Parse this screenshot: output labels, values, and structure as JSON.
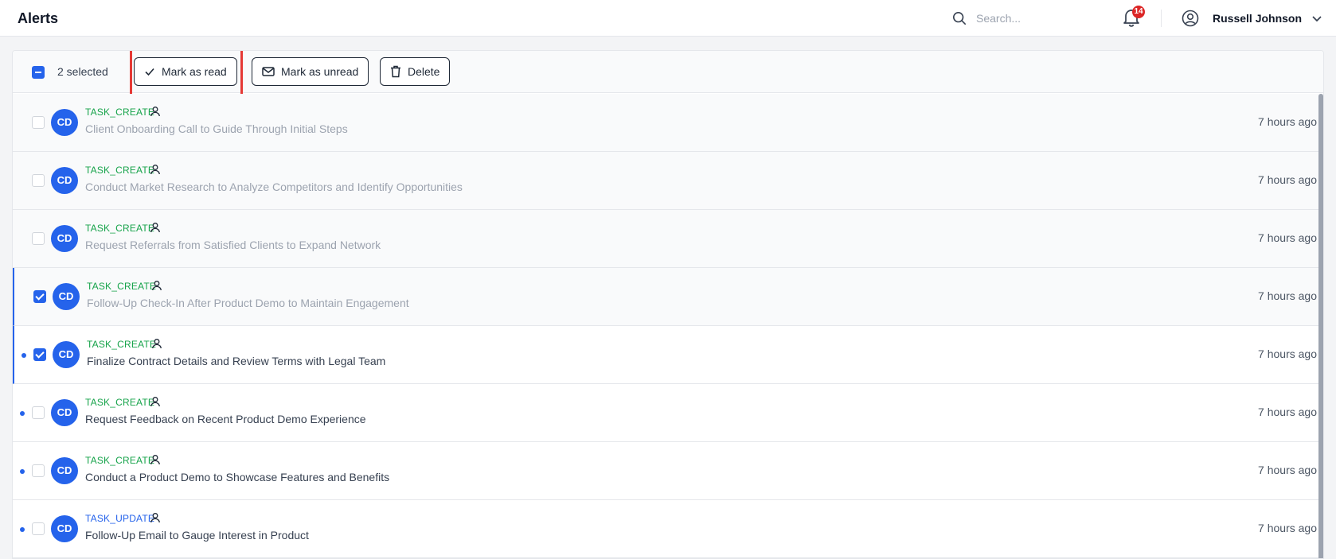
{
  "app": {
    "title": "Alerts"
  },
  "search": {
    "placeholder": "Search..."
  },
  "notifications": {
    "count": "14"
  },
  "user": {
    "name": "Russell Johnson"
  },
  "toolbar": {
    "selected_label": "2 selected",
    "mark_read_label": "Mark as read",
    "mark_unread_label": "Mark as unread",
    "delete_label": "Delete"
  },
  "alerts": [
    {
      "avatar": "CD",
      "type": "TASK_CREATE",
      "title": "Client Onboarding Call to Guide Through Initial Steps",
      "time": "7 hours ago",
      "read": true,
      "checked": false
    },
    {
      "avatar": "CD",
      "type": "TASK_CREATE",
      "title": "Conduct Market Research to Analyze Competitors and Identify Opportunities",
      "time": "7 hours ago",
      "read": true,
      "checked": false
    },
    {
      "avatar": "CD",
      "type": "TASK_CREATE",
      "title": "Request Referrals from Satisfied Clients to Expand Network",
      "time": "7 hours ago",
      "read": true,
      "checked": false
    },
    {
      "avatar": "CD",
      "type": "TASK_CREATE",
      "title": "Follow-Up Check-In After Product Demo to Maintain Engagement",
      "time": "7 hours ago",
      "read": true,
      "checked": true
    },
    {
      "avatar": "CD",
      "type": "TASK_CREATE",
      "title": "Finalize Contract Details and Review Terms with Legal Team",
      "time": "7 hours ago",
      "read": false,
      "checked": true
    },
    {
      "avatar": "CD",
      "type": "TASK_CREATE",
      "title": "Request Feedback on Recent Product Demo Experience",
      "time": "7 hours ago",
      "read": false,
      "checked": false
    },
    {
      "avatar": "CD",
      "type": "TASK_CREATE",
      "title": "Conduct a Product Demo to Showcase Features and Benefits",
      "time": "7 hours ago",
      "read": false,
      "checked": false
    },
    {
      "avatar": "CD",
      "type": "TASK_UPDATE",
      "title": "Follow-Up Email to Gauge Interest in Product",
      "time": "7 hours ago",
      "read": false,
      "checked": false
    }
  ],
  "colors": {
    "accent": "#2563eb",
    "create": "#16a34a",
    "badge": "#dc2626",
    "highlight": "#e53935"
  }
}
